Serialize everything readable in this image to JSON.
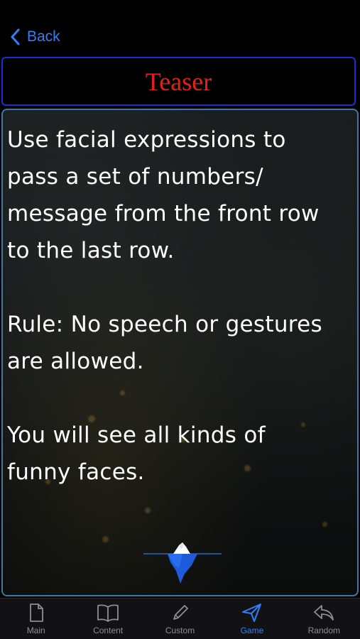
{
  "nav": {
    "back_label": "Back"
  },
  "title": "Teaser",
  "content": {
    "text": "Use facial expressions to\npass a set of numbers/\nmessage from the front row\nto the last row.\n\nRule: No speech or gestures\nare allowed.\n\nYou will see all kinds of\nfunny faces."
  },
  "tabs": [
    {
      "label": "Main",
      "icon": "document-icon",
      "active": false
    },
    {
      "label": "Content",
      "icon": "book-icon",
      "active": false
    },
    {
      "label": "Custom",
      "icon": "pencil-icon",
      "active": false
    },
    {
      "label": "Game",
      "icon": "paper-plane-icon",
      "active": true
    },
    {
      "label": "Random",
      "icon": "reply-arrow-icon",
      "active": false
    }
  ],
  "colors": {
    "accent": "#2f7ff7",
    "title": "#e4201b",
    "title_border": "#1d2bd8",
    "card_border": "#3a7aa6",
    "tab_inactive": "#8e8e93"
  }
}
